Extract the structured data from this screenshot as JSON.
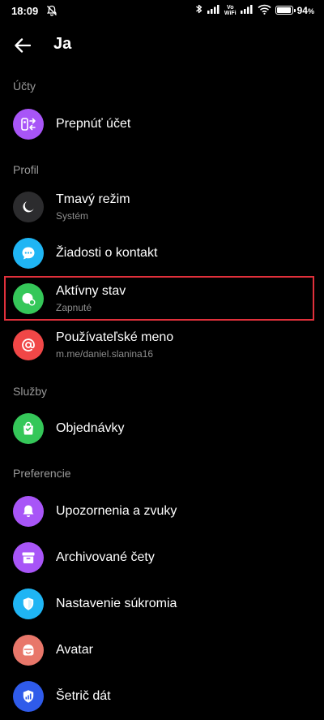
{
  "status_bar": {
    "time": "18:09",
    "vo_wifi": "Vo\nWiFi",
    "battery_percent_text": "94",
    "battery_percent_sign": "%",
    "battery_level": 0.94
  },
  "app_bar": {
    "title": "Ja"
  },
  "sections": {
    "accounts": "Účty",
    "profile": "Profil",
    "services": "Služby",
    "preferences": "Preferencie"
  },
  "items": {
    "switch_account": {
      "label": "Prepnúť účet",
      "color": "#a855f7",
      "icon": "switch-account-icon"
    },
    "dark_mode": {
      "label": "Tmavý režim",
      "sub": "Systém",
      "color": "#2c2c2e",
      "icon": "moon-icon"
    },
    "contact_requests": {
      "label": "Žiadosti o kontakt",
      "color": "#1fb5f4",
      "icon": "chat-bubble-icon"
    },
    "active_status": {
      "label": "Aktívny stav",
      "sub": "Zapnuté",
      "color": "#35c759",
      "icon": "active-status-icon"
    },
    "username": {
      "label": "Používateľské meno",
      "sub": "m.me/daniel.slanina16",
      "color": "#f04747",
      "icon": "at-icon"
    },
    "orders": {
      "label": "Objednávky",
      "color": "#35c759",
      "icon": "shopping-bag-icon"
    },
    "notifications": {
      "label": "Upozornenia a zvuky",
      "color": "#a855f7",
      "icon": "bell-icon"
    },
    "archived_chats": {
      "label": "Archivované čety",
      "color": "#a855f7",
      "icon": "archive-box-icon"
    },
    "privacy": {
      "label": "Nastavenie súkromia",
      "color": "#1fb5f4",
      "icon": "shield-icon"
    },
    "avatar": {
      "label": "Avatar",
      "color": "#e8776a",
      "icon": "avatar-icon"
    },
    "data_saver": {
      "label": "Šetrič dát",
      "color": "#2f5bea",
      "icon": "data-saver-icon"
    }
  },
  "highlight_color": "#e0303b"
}
